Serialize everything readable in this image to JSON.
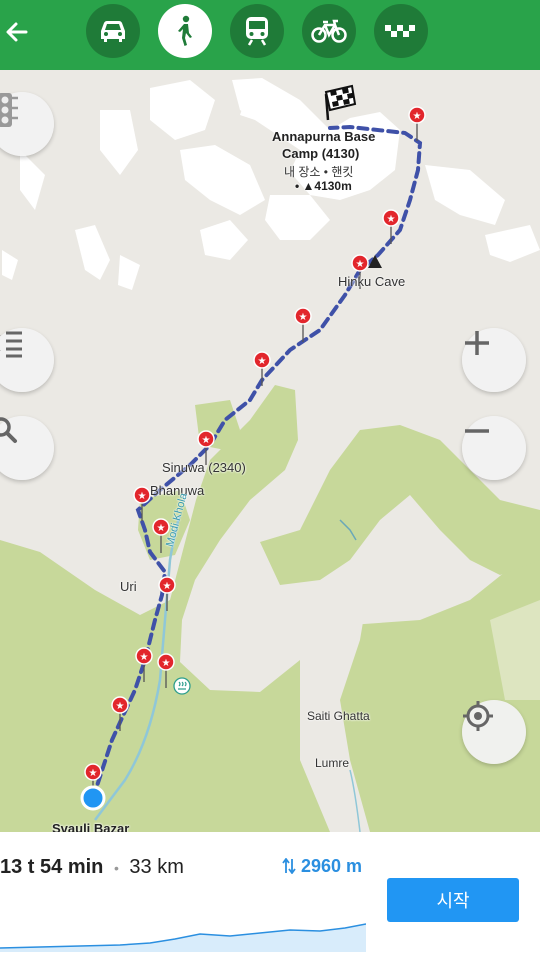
{
  "header": {
    "modes": [
      {
        "name": "car-icon",
        "active": false
      },
      {
        "name": "walk-icon",
        "active": true
      },
      {
        "name": "transit-icon",
        "active": false
      },
      {
        "name": "bicycle-icon",
        "active": false
      },
      {
        "name": "taxi-icon",
        "active": false
      }
    ]
  },
  "map": {
    "destination": {
      "name": "Annapurna Base",
      "name2": "Camp (4130)",
      "sub": "내 장소 • 핸킷",
      "elev": "• ▲4130m"
    },
    "places": {
      "hinku": "Hinku Cave",
      "sinuwa": "Sinuwa (2340)",
      "bhanuwa": "Bhanuwa",
      "uri": "Uri",
      "saiti": "Saiti Ghatta",
      "lumre": "Lumre",
      "svauli": "Svauli Bazar",
      "river": "Modi Khola"
    }
  },
  "route": {
    "duration": "13 t 54 min",
    "separator": "•",
    "distance": "33 km",
    "elevation": "2960 m",
    "start_label": "시작"
  },
  "colors": {
    "header": "#29a34a",
    "route": "#3f51a8",
    "forest": "#c7d89a",
    "start_button": "#2196f3",
    "elevation_text": "#2b8fe0"
  }
}
